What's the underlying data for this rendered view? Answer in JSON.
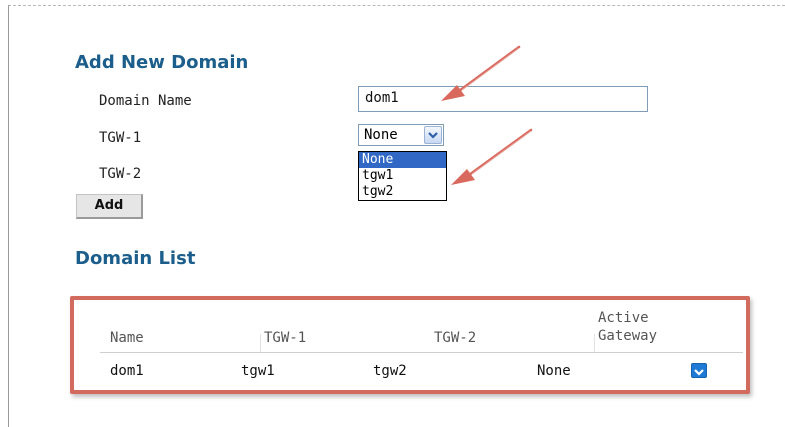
{
  "add_section": {
    "title": "Add New Domain",
    "domain_name_label": "Domain Name",
    "domain_name_value": "dom1",
    "tgw1_label": "TGW-1",
    "tgw1_selected": "None",
    "tgw1_options": [
      "None",
      "tgw1",
      "tgw2"
    ],
    "tgw2_label": "TGW-2",
    "add_button": "Add"
  },
  "list_section": {
    "title": "Domain List",
    "columns": {
      "name": "Name",
      "tgw1": "TGW-1",
      "tgw2": "TGW-2",
      "active_line1": "Active",
      "active_line2": "Gateway"
    },
    "rows": [
      {
        "name": "dom1",
        "tgw1": "tgw1",
        "tgw2": "tgw2",
        "active_gateway": "None",
        "icon": "dropdown-toggle-icon"
      }
    ]
  },
  "colors": {
    "heading": "#1b5e8c",
    "highlight": "#d36a5e",
    "selection": "#3168c5",
    "icon_blue": "#1e7ad4"
  }
}
